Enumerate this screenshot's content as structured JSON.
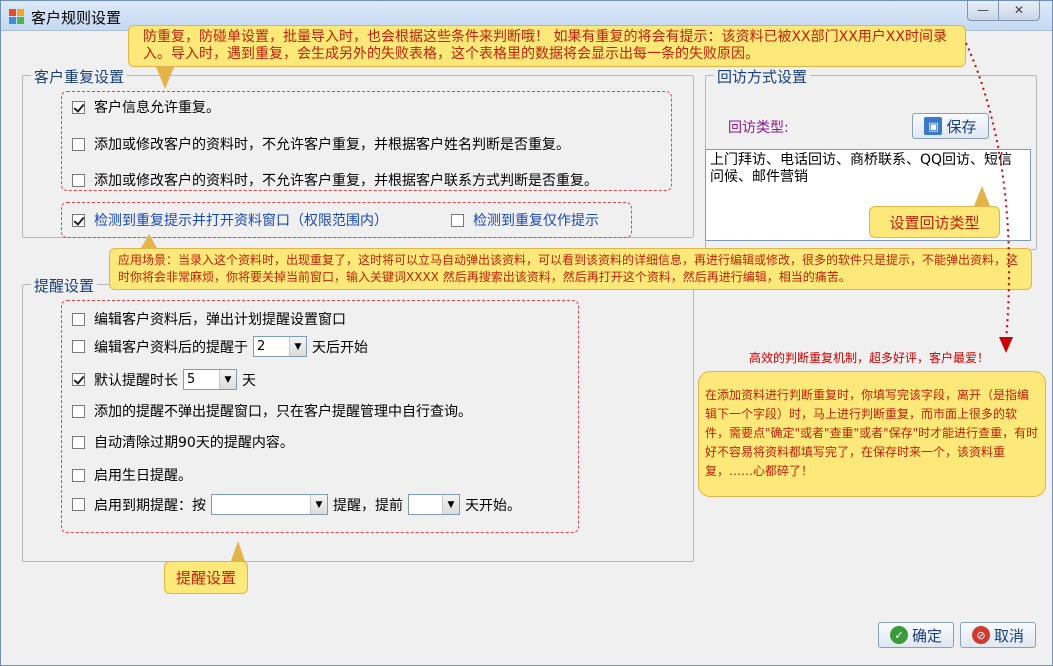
{
  "window": {
    "title": "客户规则设置"
  },
  "duplicate_group": {
    "legend": "客户重复设置",
    "options": [
      {
        "label": "客户信息允许重复。",
        "checked": true
      },
      {
        "label": "添加或修改客户的资料时，不允许客户重复，并根据客户姓名判断是否重复。",
        "checked": false
      },
      {
        "label": "添加或修改客户的资料时，不允许客户重复，并根据客户联系方式判断是否重复。",
        "checked": false
      }
    ],
    "detect_open_label": "检测到重复提示并打开资料窗口（权限范围内）",
    "detect_open_checked": true,
    "detect_only_label": "检测到重复仅作提示",
    "detect_only_checked": false
  },
  "reminder_group": {
    "legend": "提醒设置",
    "option1": "编辑客户资料后，弹出计划提醒设置窗口",
    "option2_prefix": "编辑客户资料后的提醒于",
    "option2_value": "2",
    "option2_suffix": "天后开始",
    "option3_prefix": "默认提醒时长",
    "option3_value": "5",
    "option3_suffix": "天",
    "option4": "添加的提醒不弹出提醒窗口，只在客户提醒管理中自行查询。",
    "option5": "自动清除过期90天的提醒内容。",
    "option6": "启用生日提醒。",
    "option7_prefix": "启用到期提醒：按",
    "option7_value": "",
    "option7_middle": "提醒，提前",
    "option7_days": "",
    "option7_suffix": "天开始。"
  },
  "visit_group": {
    "legend": "回访方式设置",
    "type_label": "回访类型:",
    "save_label": "保存",
    "types_text": "上门拜访、电话回访、商桥联系、QQ回访、短信问候、邮件营销"
  },
  "callouts": {
    "top": "防重复，防碰单设置，批量导入时，也会根据这些条件来判断哦！  如果有重复的将会有提示：该资料已被XX部门XX用户XX时间录入。导入时，遇到重复，会生成另外的失败表格，这个表格里的数据将会显示出每一条的失败原因。",
    "scene": "应用场景：当录入这个资料时，出现重复了，这时将可以立马自动弹出该资料，可以看到该资料的详细信息，再进行编辑或修改，很多的软件只是提示，不能弹出资料，这时你将会非常麻烦，你将要关掉当前窗口，输入关键词XXXX  然后再搜索出该资料，然后再打开这个资料，然后再进行编辑，相当的痛苦。",
    "visit_type": "设置回访类型",
    "reminder": "提醒设置",
    "slogan": "高效的判断重复机制，超多好评，客户最爱！",
    "judge": "在添加资料进行判断重复时，你填写完该字段，离开（是指编辑下一个字段）时，马上进行判断重复，而市面上很多的软件，需要点\"确定\"或者\"查重\"或者\"保存\"时才能进行查重，有时好不容易将资料都填写完了，在保存时来一个，该资料重复，……心都碎了！"
  },
  "footer": {
    "ok_label": "确定",
    "cancel_label": "取消"
  },
  "colors": {
    "callout_bg": "#fde97a",
    "callout_text": "#c0220b",
    "dashed_border": "#e0474a",
    "legend_text": "#1b3f78"
  }
}
